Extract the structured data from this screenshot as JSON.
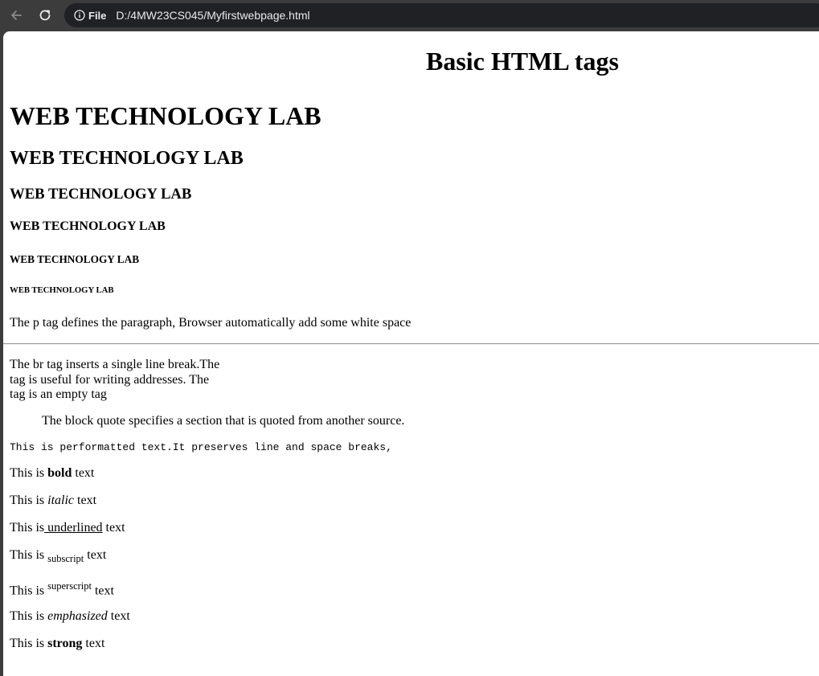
{
  "browser": {
    "back_icon": "arrow-left-icon",
    "reload_icon": "reload-icon",
    "info_icon": "info-circle-icon",
    "security_label": "File",
    "url": "D:/4MW23CS045/Myfirstwebpage.html"
  },
  "page": {
    "title": "Basic HTML tags",
    "headings": [
      "WEB TECHNOLOGY LAB",
      "WEB TECHNOLOGY LAB",
      "WEB TECHNOLOGY LAB",
      "WEB TECHNOLOGY LAB",
      "WEB TECHNOLOGY LAB",
      "WEB TECHNOLOGY LAB"
    ],
    "paragraph": "The p tag defines the paragraph, Browser automatically add some white space",
    "br_lines": [
      "The br tag inserts a single line break.The",
      "tag is useful for writing addresses. The",
      "tag is an empty tag"
    ],
    "blockquote": "The block quote specifies a section that is quoted from another source.",
    "preformatted": "This is performatted text.It preserves line and space breaks,",
    "formatting": {
      "prefix": "This is",
      "suffix": "text",
      "bold": "bold",
      "italic": "italic",
      "underlined": " underlined",
      "subscript": "subscript",
      "superscript": "superscript",
      "emphasized": "emphasized",
      "strong": "strong"
    }
  }
}
